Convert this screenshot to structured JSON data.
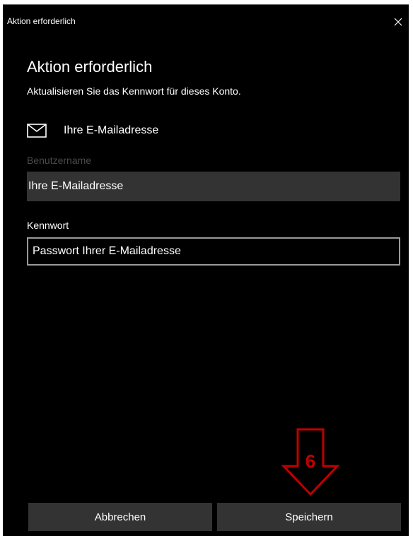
{
  "window": {
    "title": "Aktion erforderlich"
  },
  "dialog": {
    "heading": "Aktion erforderlich",
    "subtitle": "Aktualisieren Sie das Kennwort für dieses Konto.",
    "account_email": "Ihre E-Mailadresse",
    "account_icon": "mail-icon"
  },
  "form": {
    "username_label": "Benutzername",
    "username_value": "Ihre E-Mailadresse",
    "password_label": "Kennwort",
    "password_value": "Passwort Ihrer E-Mailadresse"
  },
  "buttons": {
    "cancel_label": "Abbrechen",
    "save_label": "Speichern"
  },
  "annotation": {
    "step_number": "6",
    "arrow_color": "#c00000"
  },
  "colors": {
    "background": "#000000",
    "input_fill": "#333333",
    "button_fill": "#333333",
    "muted_label": "#4a4a4a",
    "text": "#ffffff"
  }
}
